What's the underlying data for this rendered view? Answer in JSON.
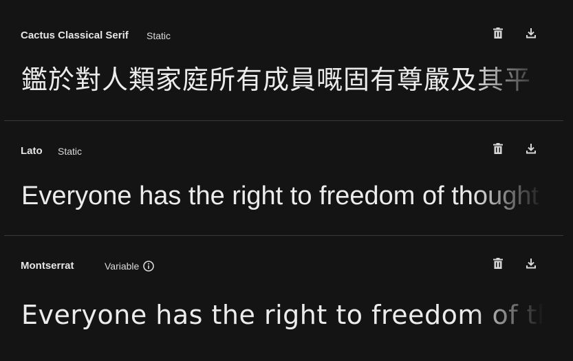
{
  "fonts": [
    {
      "name": "Cactus Classical Serif",
      "tag": "Static",
      "sample": "鑑於對人類家庭所有成員嘅固有尊嚴及其平"
    },
    {
      "name": "Lato",
      "tag": "Static",
      "sample": "Everyone has the right to freedom of thought"
    },
    {
      "name": "Montserrat",
      "tag": "Variable",
      "sample": "Everyone has the right to freedom of thought"
    }
  ],
  "icons": {
    "delete": "trash-icon",
    "download": "download-icon",
    "info": "info-icon"
  },
  "colors": {
    "background": "#141414",
    "divider": "#3a3a3a",
    "text": "#e3e3e3"
  }
}
